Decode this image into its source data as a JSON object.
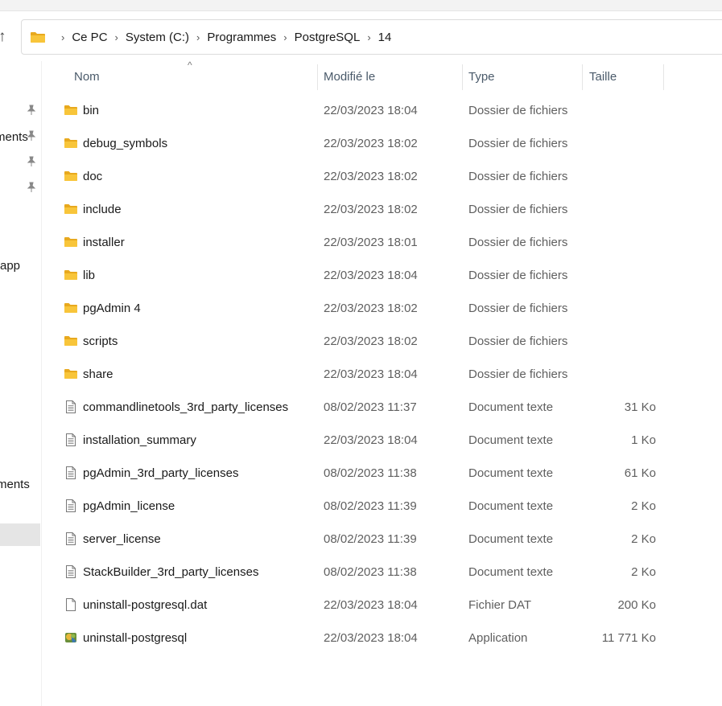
{
  "breadcrumb": [
    "Ce PC",
    "System (C:)",
    "Programmes",
    "PostgreSQL",
    "14"
  ],
  "nav": {
    "partial_items": [
      "ments",
      "app",
      "ments"
    ]
  },
  "columns": {
    "name": "Nom",
    "modified": "Modifié le",
    "type": "Type",
    "size": "Taille"
  },
  "files": [
    {
      "name": "bin",
      "modified": "22/03/2023 18:04",
      "type": "Dossier de fichiers",
      "size": "",
      "icon": "folder-icon"
    },
    {
      "name": "debug_symbols",
      "modified": "22/03/2023 18:02",
      "type": "Dossier de fichiers",
      "size": "",
      "icon": "folder-icon"
    },
    {
      "name": "doc",
      "modified": "22/03/2023 18:02",
      "type": "Dossier de fichiers",
      "size": "",
      "icon": "folder-icon"
    },
    {
      "name": "include",
      "modified": "22/03/2023 18:02",
      "type": "Dossier de fichiers",
      "size": "",
      "icon": "folder-icon"
    },
    {
      "name": "installer",
      "modified": "22/03/2023 18:01",
      "type": "Dossier de fichiers",
      "size": "",
      "icon": "folder-icon"
    },
    {
      "name": "lib",
      "modified": "22/03/2023 18:04",
      "type": "Dossier de fichiers",
      "size": "",
      "icon": "folder-icon"
    },
    {
      "name": "pgAdmin 4",
      "modified": "22/03/2023 18:02",
      "type": "Dossier de fichiers",
      "size": "",
      "icon": "folder-icon"
    },
    {
      "name": "scripts",
      "modified": "22/03/2023 18:02",
      "type": "Dossier de fichiers",
      "size": "",
      "icon": "folder-icon"
    },
    {
      "name": "share",
      "modified": "22/03/2023 18:04",
      "type": "Dossier de fichiers",
      "size": "",
      "icon": "folder-icon"
    },
    {
      "name": "commandlinetools_3rd_party_licenses",
      "modified": "08/02/2023 11:37",
      "type": "Document texte",
      "size": "31 Ko",
      "icon": "text-file-icon"
    },
    {
      "name": "installation_summary",
      "modified": "22/03/2023 18:04",
      "type": "Document texte",
      "size": "1 Ko",
      "icon": "text-file-icon"
    },
    {
      "name": "pgAdmin_3rd_party_licenses",
      "modified": "08/02/2023 11:38",
      "type": "Document texte",
      "size": "61 Ko",
      "icon": "text-file-icon"
    },
    {
      "name": "pgAdmin_license",
      "modified": "08/02/2023 11:39",
      "type": "Document texte",
      "size": "2 Ko",
      "icon": "text-file-icon"
    },
    {
      "name": "server_license",
      "modified": "08/02/2023 11:39",
      "type": "Document texte",
      "size": "2 Ko",
      "icon": "text-file-icon"
    },
    {
      "name": "StackBuilder_3rd_party_licenses",
      "modified": "08/02/2023 11:38",
      "type": "Document texte",
      "size": "2 Ko",
      "icon": "text-file-icon"
    },
    {
      "name": "uninstall-postgresql.dat",
      "modified": "22/03/2023 18:04",
      "type": "Fichier DAT",
      "size": "200 Ko",
      "icon": "blank-file-icon"
    },
    {
      "name": "uninstall-postgresql",
      "modified": "22/03/2023 18:04",
      "type": "Application",
      "size": "11 771 Ko",
      "icon": "application-icon"
    }
  ],
  "colors": {
    "folder": "#f8c53a",
    "folder_dark": "#e8a91e",
    "selected_nav": "#e5e5e5",
    "header_text": "#4a5a6a"
  }
}
